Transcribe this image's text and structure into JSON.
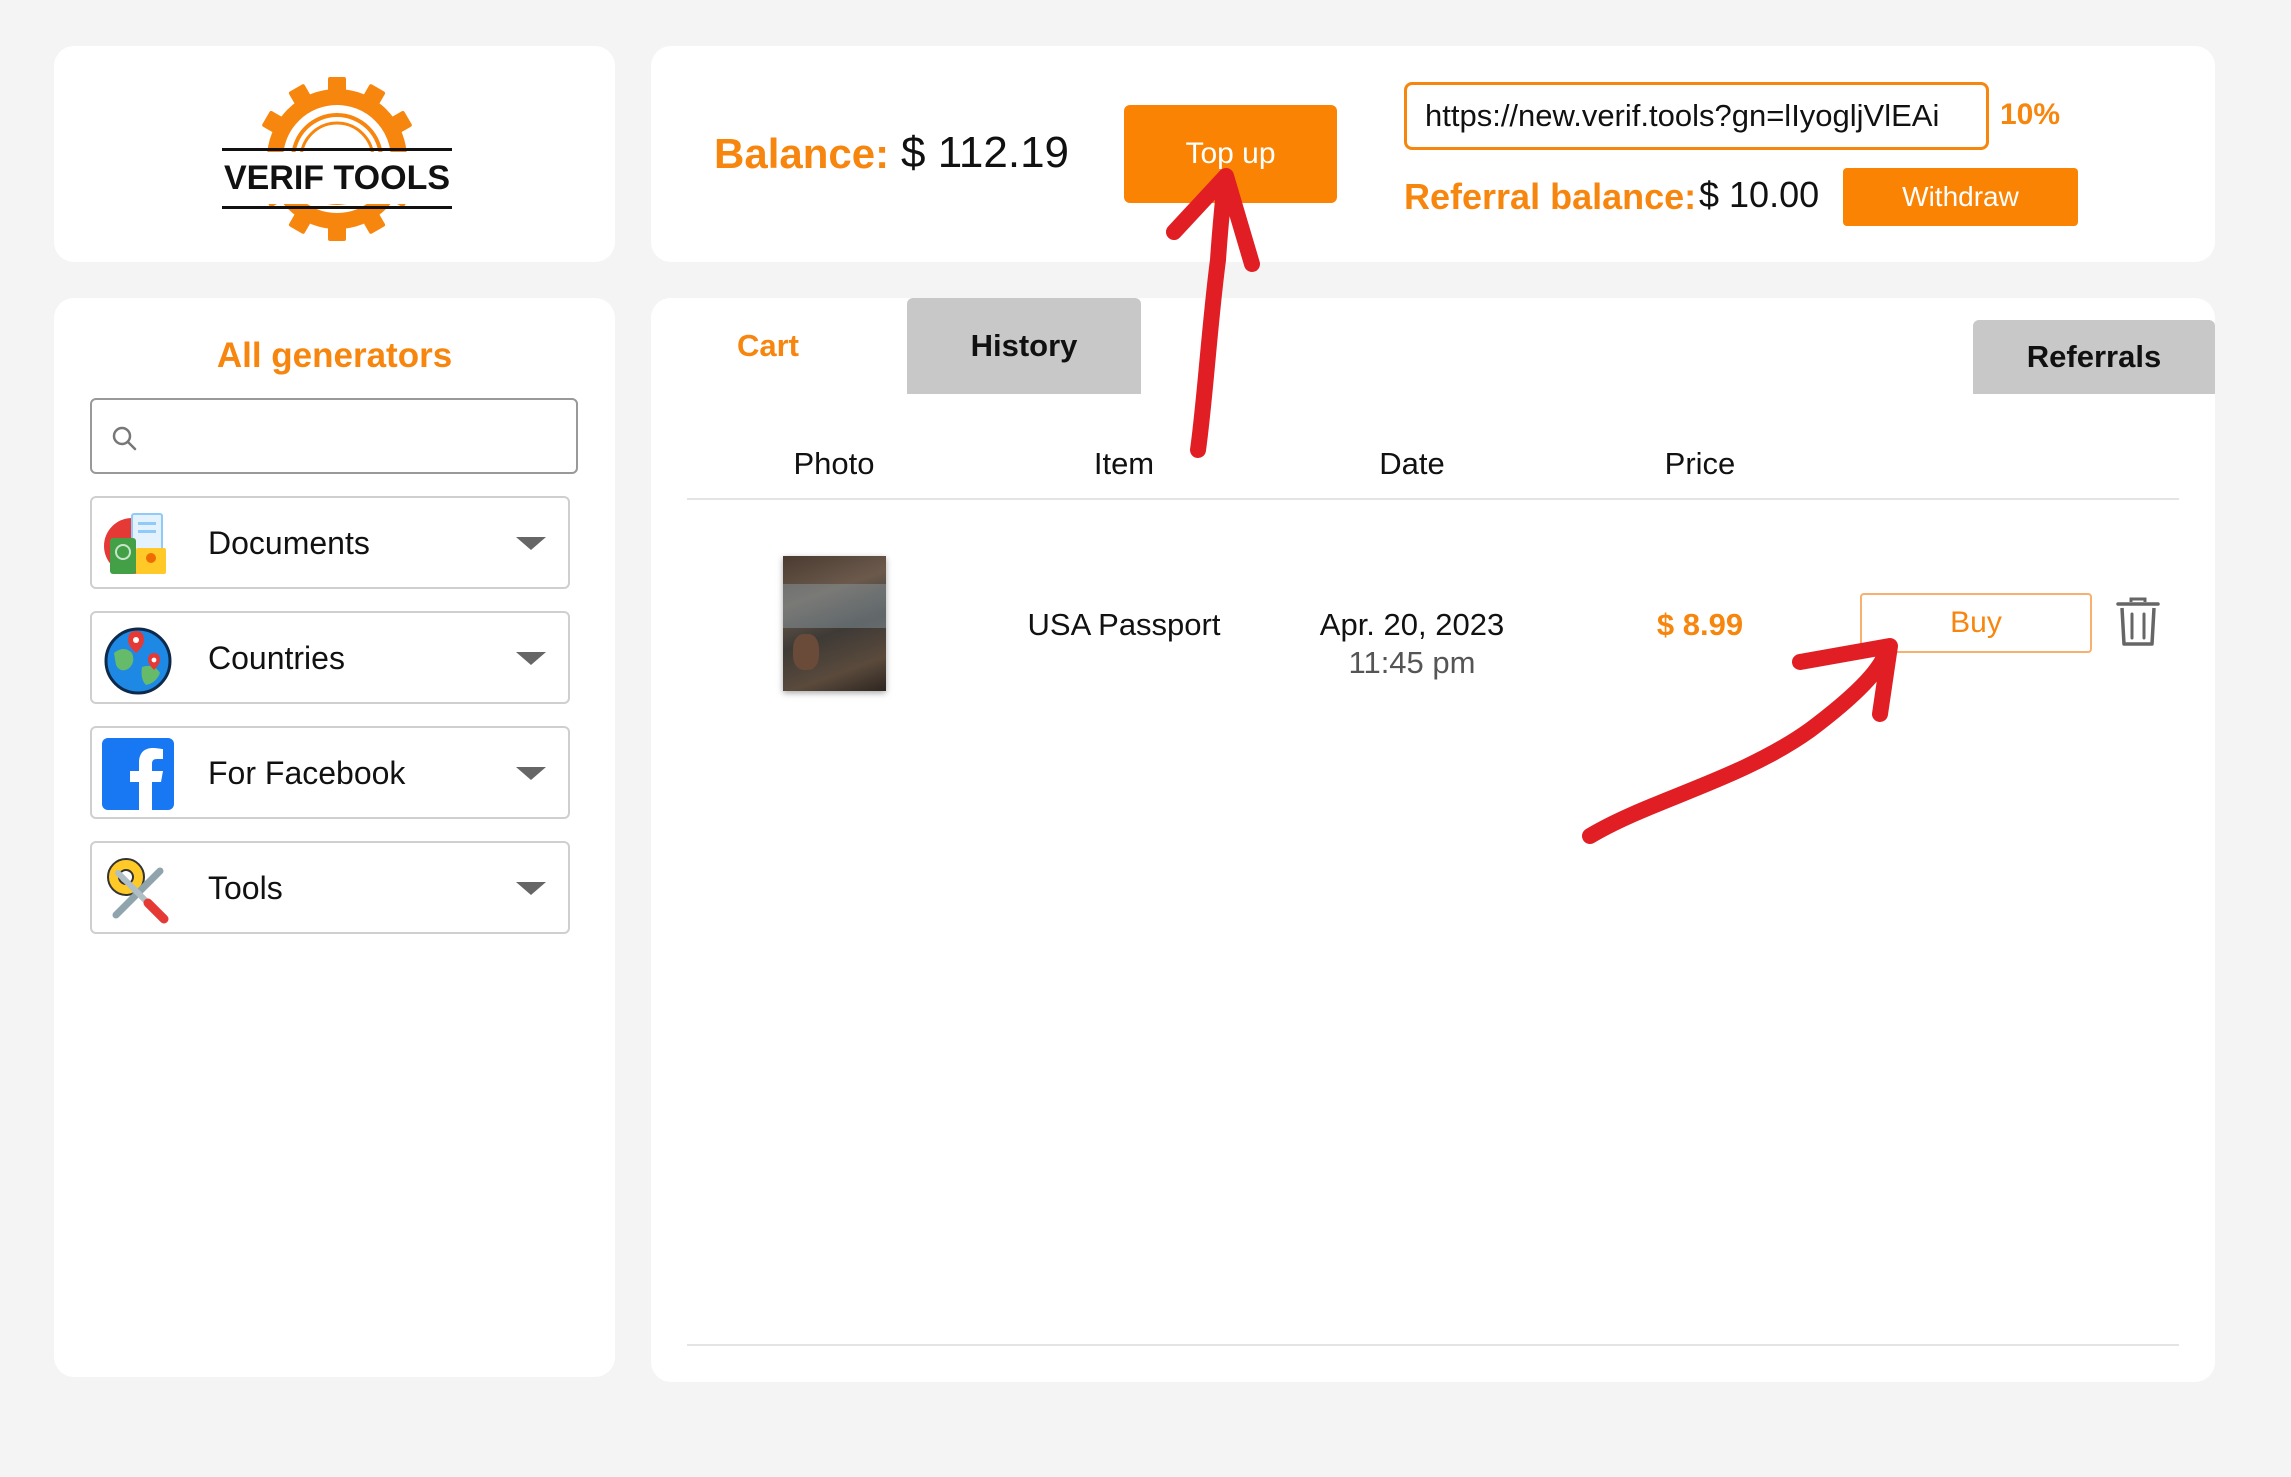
{
  "logo": {
    "text": "VERIF TOOLS",
    "icon": "gear-logo-icon"
  },
  "balance": {
    "label": "Balance:",
    "value": "$ 112.19",
    "topup_label": "Top up",
    "referral_link": "https://new.verif.tools?gn=lIyogljVlEAi",
    "referral_percent": "10%",
    "referral_balance_label": "Referral balance:",
    "referral_balance_value": "$ 10.00",
    "withdraw_label": "Withdraw"
  },
  "sidebar": {
    "title": "All generators",
    "search_placeholder": "",
    "items": [
      {
        "label": "Documents",
        "icon": "documents-icon"
      },
      {
        "label": "Countries",
        "icon": "globe-icon"
      },
      {
        "label": "For Facebook",
        "icon": "facebook-icon"
      },
      {
        "label": "Tools",
        "icon": "tools-icon"
      }
    ]
  },
  "tabs": {
    "cart": "Cart",
    "history": "History",
    "referrals": "Referrals"
  },
  "table": {
    "headers": {
      "photo": "Photo",
      "item": "Item",
      "date": "Date",
      "price": "Price"
    },
    "rows": [
      {
        "item": "USA Passport",
        "date": "Apr. 20, 2023",
        "time": "11:45 pm",
        "price": "$ 8.99",
        "action": "Buy"
      }
    ]
  },
  "colors": {
    "accent": "#fb8303",
    "accent_text": "#f7860f",
    "annotation": "#e01e24",
    "background": "#f4f4f4"
  }
}
